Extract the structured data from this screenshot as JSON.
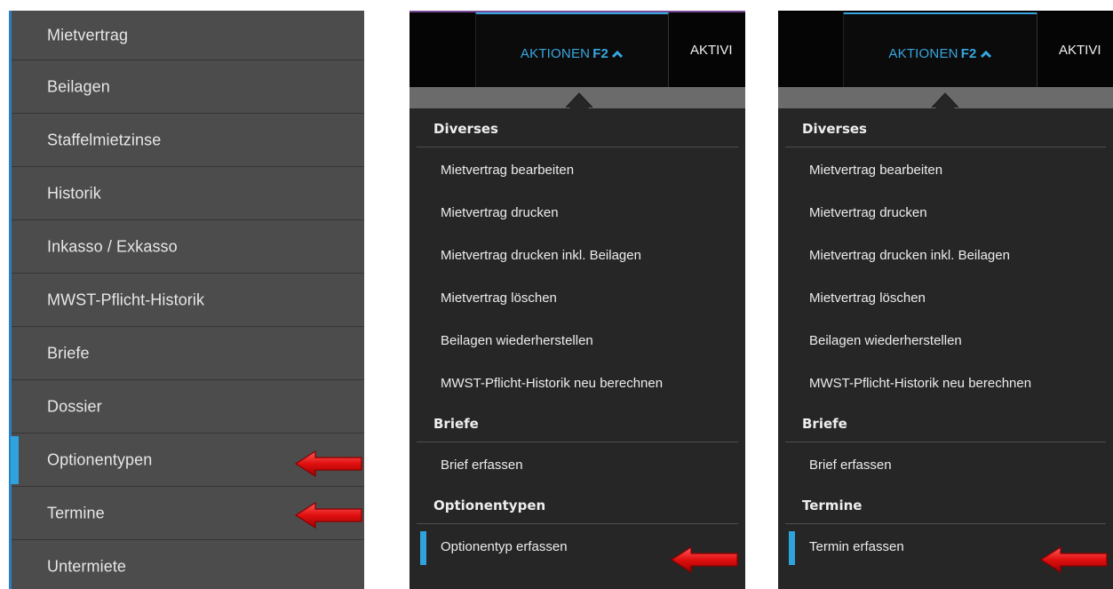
{
  "sidebar": {
    "items": [
      {
        "label": "Mietvertrag",
        "active": false
      },
      {
        "label": "Beilagen",
        "active": false
      },
      {
        "label": "Staffelmietzinse",
        "active": false
      },
      {
        "label": "Historik",
        "active": false
      },
      {
        "label": "Inkasso / Exkasso",
        "active": false
      },
      {
        "label": "MWST-Pflicht-Historik",
        "active": false
      },
      {
        "label": "Briefe",
        "active": false
      },
      {
        "label": "Dossier",
        "active": false
      },
      {
        "label": "Optionentypen",
        "active": true
      },
      {
        "label": "Termine",
        "active": false
      },
      {
        "label": "Untermiete",
        "active": false
      }
    ]
  },
  "panels": [
    {
      "tab_label": "AKTIONEN",
      "tab_shortcut": "F2",
      "tab_next": "AKTIVI",
      "sections": [
        {
          "title": "Diverses",
          "items": [
            "Mietvertrag bearbeiten",
            "Mietvertrag drucken",
            "Mietvertrag drucken inkl. Beilagen",
            "Mietvertrag löschen",
            "Beilagen wiederherstellen",
            "MWST-Pflicht-Historik neu berechnen"
          ]
        },
        {
          "title": "Briefe",
          "items": [
            "Brief erfassen"
          ]
        },
        {
          "title": "Optionentypen",
          "items": [
            "Optionentyp erfassen"
          ]
        }
      ]
    },
    {
      "tab_label": "AKTIONEN",
      "tab_shortcut": "F2",
      "tab_next": "AKTIVI",
      "sections": [
        {
          "title": "Diverses",
          "items": [
            "Mietvertrag bearbeiten",
            "Mietvertrag drucken",
            "Mietvertrag drucken inkl. Beilagen",
            "Mietvertrag löschen",
            "Beilagen wiederherstellen",
            "MWST-Pflicht-Historik neu berechnen"
          ]
        },
        {
          "title": "Briefe",
          "items": [
            "Brief erfassen"
          ]
        },
        {
          "title": "Termine",
          "items": [
            "Termin erfassen"
          ]
        }
      ]
    }
  ],
  "icons": {
    "tab_chevron": "chevron-up-icon",
    "arrow": "red-arrow-icon"
  },
  "colors": {
    "accent": "#37a7e0",
    "active_marker": "#2fa3dd",
    "arrow_red": "#e01010",
    "sidebar_bg": "#4c4c4c",
    "menu_bg": "#262626"
  }
}
